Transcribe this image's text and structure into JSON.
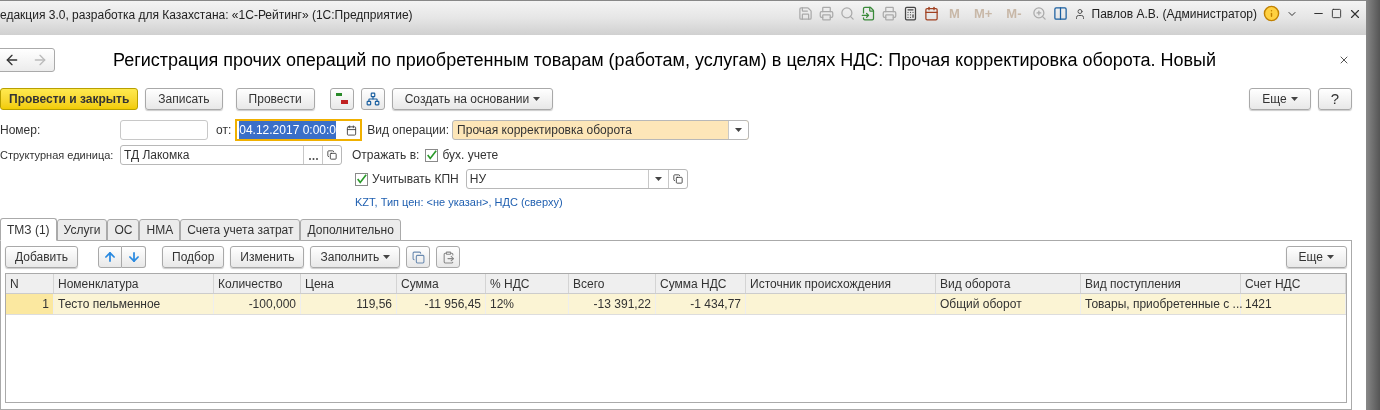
{
  "app": {
    "title": "едакция 3.0, разработка для Казахстана: «1С-Рейтинг»  (1С:Предприятие)",
    "memory_buttons": [
      "M",
      "M+",
      "M-"
    ],
    "user": "Павлов А.В. (Администратор)"
  },
  "form": {
    "title": "Регистрация прочих операций по приобретенным товарам (работам, услугам) в целях НДС: Прочая корректировка оборота. Новый"
  },
  "commands": [
    {
      "label": "Провести и закрыть",
      "kind": "primary"
    },
    {
      "label": "Записать",
      "kind": "plain"
    },
    {
      "label": "Провести",
      "kind": "plain"
    },
    {
      "label": "Создать на основании",
      "kind": "menu"
    }
  ],
  "more": "Еще",
  "help": "?",
  "fields": {
    "number": {
      "label": "Номер:"
    },
    "date": {
      "label": "от:",
      "value": "04.12.2017  0:00:0",
      "focused": true
    },
    "operation": {
      "label": "Вид операции:",
      "value": "Прочая корректировка оборота"
    },
    "unit": {
      "label": "Структурная единица:",
      "value": "ТД Лакомка"
    },
    "reflect": {
      "label": "Отражать в:",
      "checkbox": {
        "label": "бух. учете",
        "checked": true
      }
    },
    "kpn": {
      "checkbox": {
        "label": "Учитывать КПН",
        "checked": true
      },
      "value": "НУ"
    },
    "link": "KZT, Тип цен: <не указан>, НДС (сверху)"
  },
  "tabs": [
    {
      "label": "ТМЗ (1)",
      "selected": true
    },
    {
      "label": "Услуги",
      "selected": false
    },
    {
      "label": "ОС",
      "selected": false
    },
    {
      "label": "НМА",
      "selected": false
    },
    {
      "label": "Счета учета затрат",
      "selected": false
    },
    {
      "label": "Дополнительно",
      "selected": false
    }
  ],
  "table_toolbar": {
    "add": "Добавить",
    "pick": "Подбор",
    "edit": "Изменить",
    "fill": "Заполнить",
    "more": "Еще"
  },
  "table": {
    "columns": [
      "N",
      "Номенклатура",
      "Количество",
      "Цена",
      "Сумма",
      "% НДС",
      "Всего",
      "Сумма НДС",
      "Источник происхождения",
      "Вид оборота",
      "Вид поступления",
      "Счет НДС"
    ],
    "rows": [
      {
        "selected": true,
        "cells": [
          "1",
          "Тесто пельменное",
          "-100,000",
          "119,56",
          "-11 956,45",
          "12%",
          "-13 391,22",
          "-1 434,77",
          "",
          "Общий оборот",
          "Товары, приобретенные с ...",
          "1421"
        ]
      }
    ]
  }
}
